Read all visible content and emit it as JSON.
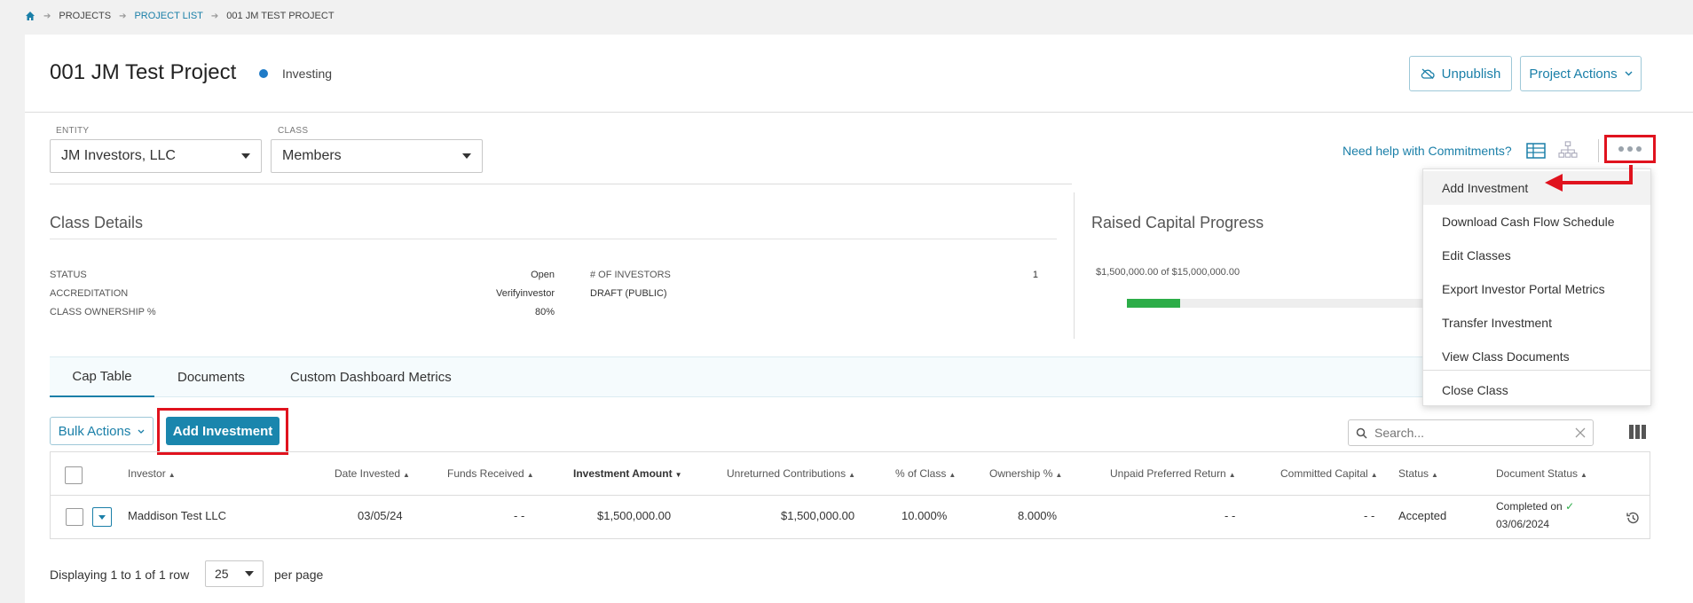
{
  "breadcrumb": {
    "items": [
      "PROJECTS",
      "PROJECT LIST",
      "001 JM TEST PROJECT"
    ]
  },
  "header": {
    "title": "001 JM Test Project",
    "status": "Investing",
    "unpublish_label": "Unpublish",
    "project_actions_label": "Project Actions"
  },
  "filters": {
    "entity_label": "ENTITY",
    "entity_value": "JM Investors, LLC",
    "class_label": "CLASS",
    "class_value": "Members",
    "help_link": "Need help with Commitments?"
  },
  "class_details": {
    "title": "Class Details",
    "rows_left": [
      {
        "label": "STATUS",
        "value": "Open"
      },
      {
        "label": "ACCREDITATION",
        "value": "Verifyinvestor"
      },
      {
        "label": "CLASS OWNERSHIP %",
        "value": "80%"
      }
    ],
    "rows_right": [
      {
        "label": "# OF INVESTORS",
        "value": "1"
      },
      {
        "label": "DRAFT (PUBLIC)",
        "value": ""
      }
    ]
  },
  "raised_capital": {
    "title": "Raised Capital Progress",
    "summary": "$1,500,000.00 of $15,000,000.00",
    "progress_fraction": 0.1
  },
  "tabs": [
    {
      "label": "Cap Table",
      "active": true
    },
    {
      "label": "Documents",
      "active": false
    },
    {
      "label": "Custom Dashboard Metrics",
      "active": false
    }
  ],
  "toolbar": {
    "bulk_actions_label": "Bulk Actions",
    "add_investment_label": "Add Investment",
    "search_placeholder": "Search..."
  },
  "table": {
    "columns": [
      "Investor",
      "Date Invested",
      "Funds Received",
      "Investment Amount",
      "Unreturned Contributions",
      "% of Class",
      "Ownership %",
      "Unpaid Preferred Return",
      "Committed Capital",
      "Status",
      "Document Status"
    ],
    "rows": [
      {
        "investor": "Maddison Test LLC",
        "date_invested": "03/05/24",
        "funds_received": "- -",
        "investment_amount": "$1,500,000.00",
        "unreturned_contributions": "$1,500,000.00",
        "pct_of_class": "10.000%",
        "ownership_pct": "8.000%",
        "unpaid_preferred_return": "- -",
        "committed_capital": "- -",
        "status": "Accepted",
        "document_status": "Completed on",
        "document_date": "03/06/2024"
      }
    ]
  },
  "pagination": {
    "prefix": "Displaying 1 to 1 of 1 row",
    "per_page_value": "25",
    "suffix": "per page"
  },
  "more_menu": {
    "items": [
      "Add Investment",
      "Download Cash Flow Schedule",
      "Edit Classes",
      "Export Investor Portal Metrics",
      "Transfer Investment",
      "View Class Documents",
      "Close Class"
    ]
  },
  "colors": {
    "accent": "#1a7fa8",
    "highlight": "#e0131e",
    "progress": "#2cad48",
    "status_dot": "#1f7bc7"
  }
}
